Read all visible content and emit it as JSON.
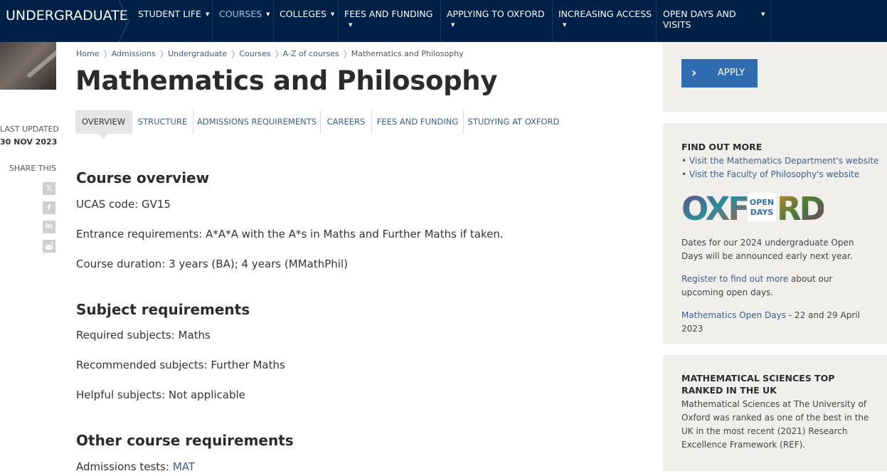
{
  "nav": {
    "brand": "UNDERGRADUATE",
    "items": [
      {
        "label": "STUDENT LIFE"
      },
      {
        "label": "COURSES"
      },
      {
        "label": "COLLEGES"
      },
      {
        "label": "FEES AND FUNDING"
      },
      {
        "label": "APPLYING TO OXFORD"
      },
      {
        "label": "INCREASING ACCESS"
      },
      {
        "label": "OPEN DAYS AND",
        "label2": "VISITS"
      }
    ]
  },
  "meta": {
    "last_updated_label": "LAST UPDATED",
    "last_updated_date": "30 NOV 2023",
    "share_label": "SHARE THIS"
  },
  "breadcrumb": [
    "Home",
    "Admissions",
    "Undergraduate",
    "Courses",
    "A-Z of courses",
    "Mathematics and Philosophy"
  ],
  "page_title": "Mathematics and Philosophy",
  "tabs": [
    "OVERVIEW",
    "STRUCTURE",
    "ADMISSIONS REQUIREMENTS",
    "CAREERS",
    "FEES AND FUNDING",
    "STUDYING AT OXFORD"
  ],
  "overview": {
    "heading": "Course overview",
    "ucas": "UCAS code: GV15",
    "entrance": "Entrance requirements: A*A*A with the A*s in Maths and Further Maths if taken.",
    "duration": "Course duration: 3 years (BA); 4 years (MMathPhil)"
  },
  "subjects": {
    "heading": "Subject requirements",
    "required": "Required subjects: Maths",
    "recommended": "Recommended subjects: Further Maths",
    "helpful": "Helpful subjects: Not applicable"
  },
  "other": {
    "heading": "Other course requirements",
    "tests_label": "Admissions tests: ",
    "tests_link": "MAT"
  },
  "sidebar": {
    "apply_label": "APPLY",
    "find_out_heading": "FIND OUT MORE",
    "link_maths": "Visit the Mathematics Department's website",
    "link_phil": "Visit the Faculty of Philosophy's website",
    "logo_text": "OXFORD OPEN DAYS",
    "logo_open": "OPEN",
    "logo_days": "DAYS",
    "dates_text": "Dates for our 2024 undergraduate Open Days will be announced early next year.",
    "register_link": "Register to find out more",
    "register_rest": " about our upcoming open days.",
    "maths_od_link": "Mathematics Open Days",
    "maths_od_rest": " - 22 and 29 April 2023",
    "ranked_heading": "MATHEMATICAL SCIENCES TOP RANKED IN THE UK",
    "ranked_text": "Mathematical Sciences at The University of Oxford was ranked as one of the best in the UK in the most recent (2021) Research Excellence Framework (REF)."
  },
  "colors": {
    "nav_bg": "#002147",
    "link": "#3a5e8c",
    "apply_bg": "#2f6db0",
    "sidebar_bg": "#f0efec"
  }
}
